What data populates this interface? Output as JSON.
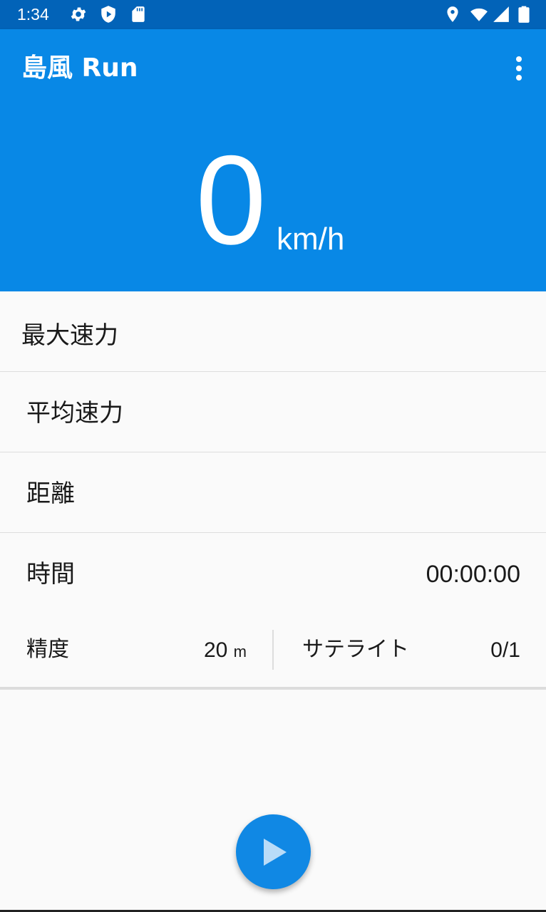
{
  "status_bar": {
    "time": "1:34",
    "left_icons": [
      "gear-icon",
      "shield-play-icon",
      "sd-card-icon"
    ],
    "right_icons": [
      "location-icon",
      "wifi-icon",
      "cellular-signal-icon",
      "battery-icon"
    ],
    "background": "#0263b8"
  },
  "app_bar": {
    "title": "島風 Run",
    "menu_icon": "more-vert-icon",
    "background": "#0888e6"
  },
  "speed": {
    "value": "0",
    "unit": "km/h"
  },
  "stats": {
    "max_speed": {
      "label": "最大速力",
      "value": ""
    },
    "avg_speed": {
      "label": "平均速力",
      "value": ""
    },
    "distance": {
      "label": "距離",
      "value": ""
    },
    "time": {
      "label": "時間",
      "value": "00:00:00"
    }
  },
  "info": {
    "accuracy_label": "精度",
    "accuracy_value": "20",
    "accuracy_unit": "m",
    "satellite_label": "サテライト",
    "satellite_value": "0/1"
  },
  "fab": {
    "icon": "play-icon",
    "color": "#1088e4"
  }
}
